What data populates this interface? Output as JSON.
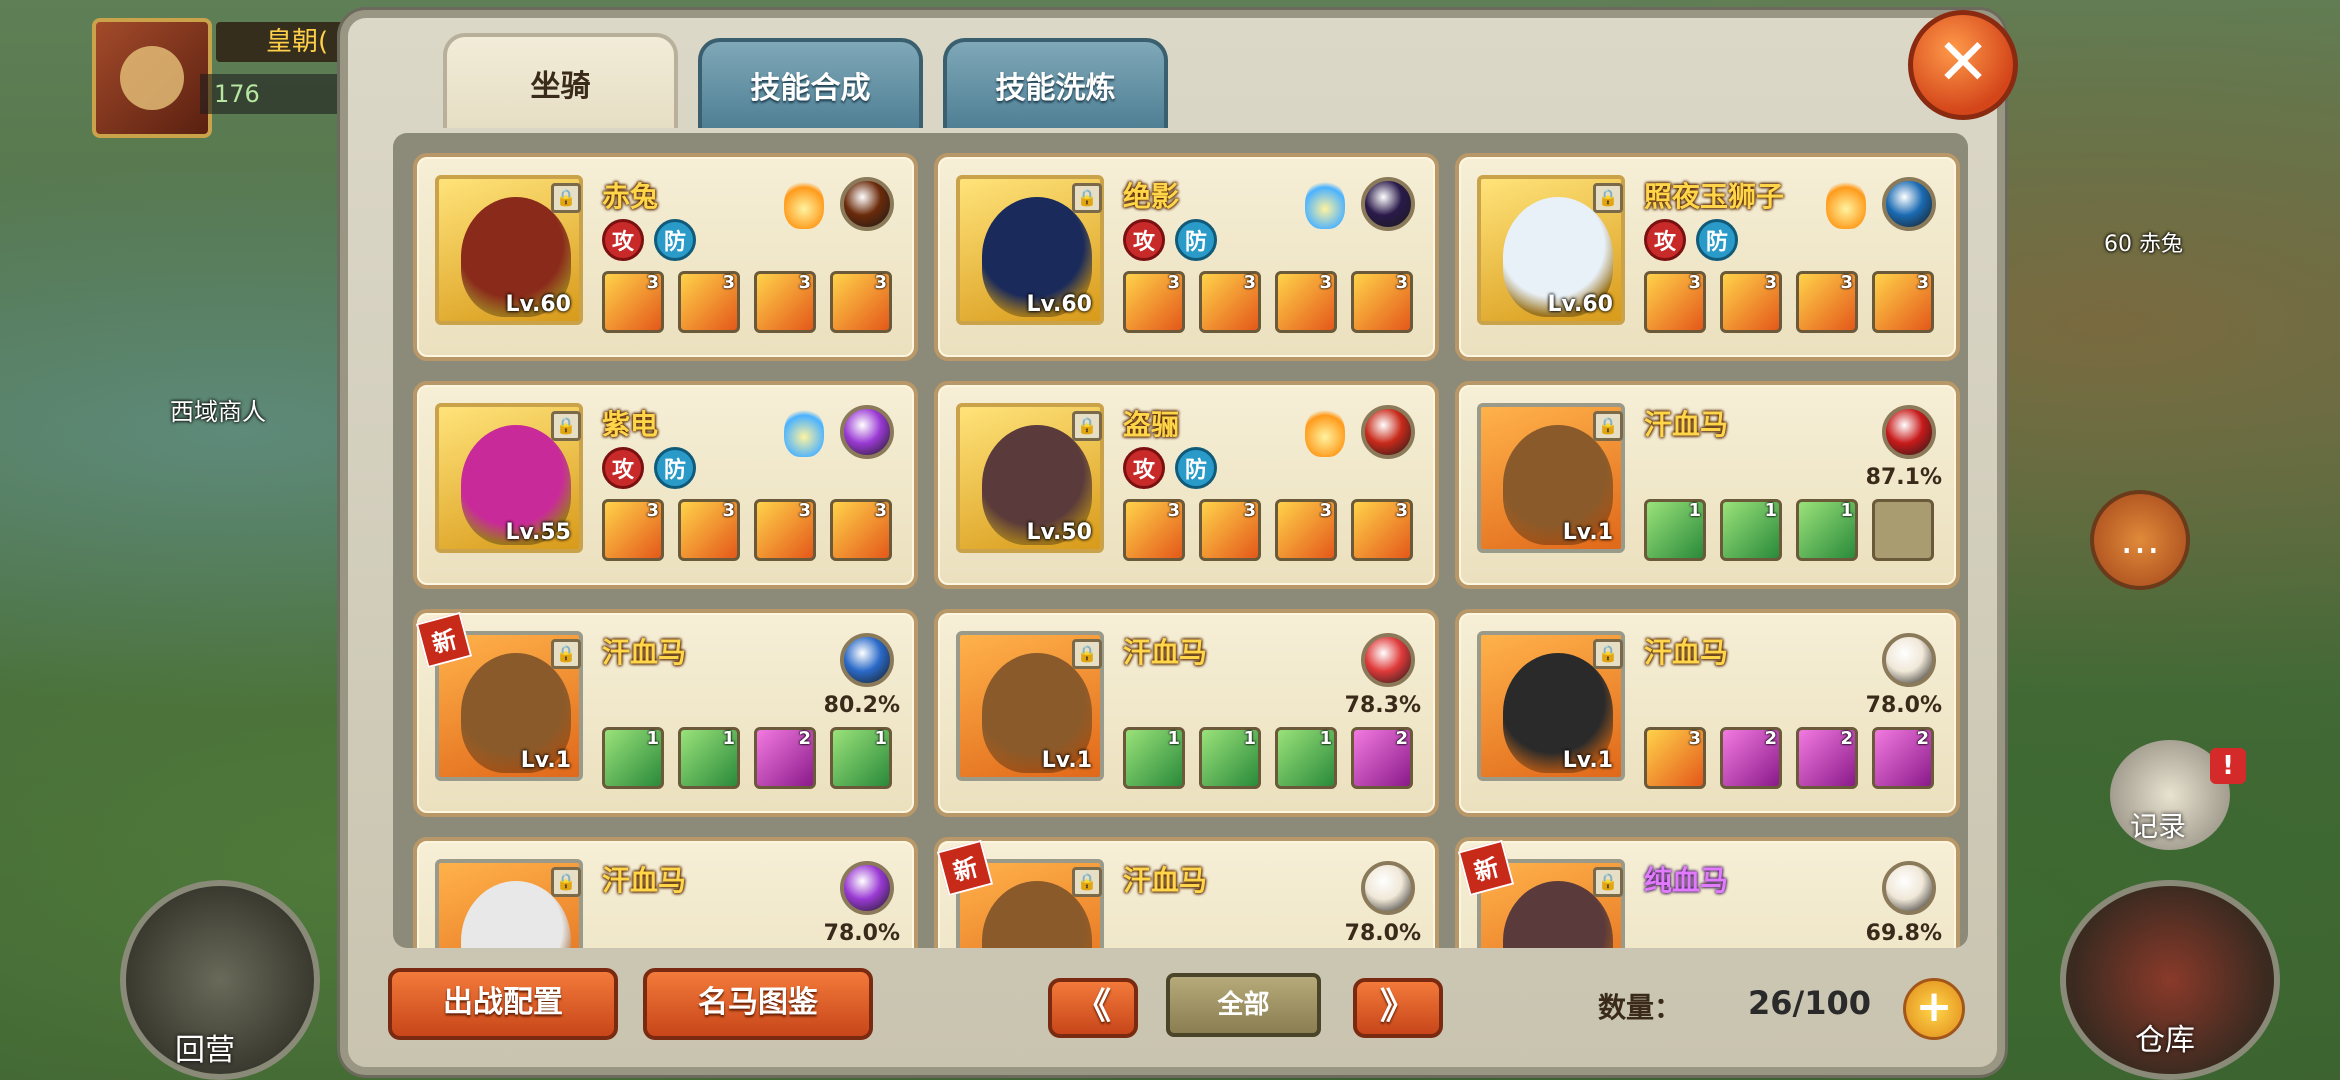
{
  "hud": {
    "title": "皇朝(",
    "level": "176"
  },
  "world": {
    "npc_label": "西域商人",
    "hero_label": "60  赤兔"
  },
  "side_buttons": {
    "home": "回营",
    "warehouse": "仓库",
    "record": "记录",
    "record_badge": "!"
  },
  "tabs": [
    {
      "label": "坐骑",
      "active": true
    },
    {
      "label": "技能合成",
      "active": false
    },
    {
      "label": "技能洗炼",
      "active": false
    }
  ],
  "close_label": "✕",
  "attr_labels": {
    "attack": "攻",
    "defense": "防"
  },
  "mounts": [
    {
      "name": "赤兔",
      "level": "Lv.60",
      "tier": "gold",
      "coat": "#8a2a1a",
      "elem": "#ff9a1a",
      "gem": "#6a2a0a",
      "attrs": true,
      "new": false,
      "percent": "",
      "skills": [
        {
          "type": "fire",
          "n": "3"
        },
        {
          "type": "fire",
          "n": "3"
        },
        {
          "type": "fire",
          "n": "3"
        },
        {
          "type": "fire",
          "n": "3"
        }
      ]
    },
    {
      "name": "绝影",
      "level": "Lv.60",
      "tier": "gold",
      "coat": "#1a2a5a",
      "elem": "#4ab2ff",
      "gem": "#2a1a4a",
      "attrs": true,
      "new": false,
      "percent": "",
      "skills": [
        {
          "type": "fire",
          "n": "3"
        },
        {
          "type": "fire",
          "n": "3"
        },
        {
          "type": "fire",
          "n": "3"
        },
        {
          "type": "fire",
          "n": "3"
        }
      ]
    },
    {
      "name": "照夜玉狮子",
      "level": "Lv.60",
      "tier": "gold",
      "coat": "#e8f0f8",
      "elem": "#ff9a1a",
      "gem": "#1a6ab2",
      "attrs": true,
      "new": false,
      "percent": "",
      "skills": [
        {
          "type": "fire",
          "n": "3"
        },
        {
          "type": "fire",
          "n": "3"
        },
        {
          "type": "fire",
          "n": "3"
        },
        {
          "type": "fire",
          "n": "3"
        }
      ]
    },
    {
      "name": "紫电",
      "level": "Lv.55",
      "tier": "gold",
      "coat": "#c82a9a",
      "elem": "#4ab2ff",
      "gem": "#9a3ad4",
      "attrs": true,
      "new": false,
      "percent": "",
      "skills": [
        {
          "type": "fire",
          "n": "3"
        },
        {
          "type": "fire",
          "n": "3"
        },
        {
          "type": "fire",
          "n": "3"
        },
        {
          "type": "fire",
          "n": "3"
        }
      ]
    },
    {
      "name": "盗骊",
      "level": "Lv.50",
      "tier": "gold",
      "coat": "#5a3a3a",
      "elem": "#ff9a1a",
      "gem": "#c82a1a",
      "attrs": true,
      "new": false,
      "percent": "",
      "skills": [
        {
          "type": "fire",
          "n": "3"
        },
        {
          "type": "fire",
          "n": "3"
        },
        {
          "type": "fire",
          "n": "3"
        },
        {
          "type": "fire",
          "n": "3"
        }
      ]
    },
    {
      "name": "汗血马",
      "level": "Lv.1",
      "tier": "orange",
      "coat": "#8a5a2a",
      "elem": "",
      "gem": "#c81a1a",
      "attrs": false,
      "new": false,
      "percent": "87.1%",
      "skills": [
        {
          "type": "green",
          "n": "1"
        },
        {
          "type": "green",
          "n": "1"
        },
        {
          "type": "green",
          "n": "1"
        },
        {
          "type": "empty",
          "n": ""
        }
      ]
    },
    {
      "name": "汗血马",
      "level": "Lv.1",
      "tier": "orange",
      "coat": "#8a5a2a",
      "elem": "",
      "gem": "#2a6ac8",
      "attrs": false,
      "new": true,
      "new_label": "新",
      "percent": "80.2%",
      "skills": [
        {
          "type": "green",
          "n": "1"
        },
        {
          "type": "green",
          "n": "1"
        },
        {
          "type": "purple",
          "n": "2"
        },
        {
          "type": "green",
          "n": "1"
        }
      ]
    },
    {
      "name": "汗血马",
      "level": "Lv.1",
      "tier": "orange",
      "coat": "#8a5a2a",
      "elem": "",
      "gem": "#e03a3a",
      "attrs": false,
      "new": false,
      "percent": "78.3%",
      "skills": [
        {
          "type": "green",
          "n": "1"
        },
        {
          "type": "green",
          "n": "1"
        },
        {
          "type": "green",
          "n": "1"
        },
        {
          "type": "purple",
          "n": "2"
        }
      ]
    },
    {
      "name": "汗血马",
      "level": "Lv.1",
      "tier": "orange",
      "coat": "#2a2a2a",
      "elem": "",
      "gem": "#f0e8d8",
      "attrs": false,
      "new": false,
      "percent": "78.0%",
      "skills": [
        {
          "type": "fire",
          "n": "3"
        },
        {
          "type": "purple",
          "n": "2"
        },
        {
          "type": "purple",
          "n": "2"
        },
        {
          "type": "purple",
          "n": "2"
        }
      ]
    },
    {
      "name": "汗血马",
      "level": "",
      "tier": "orange",
      "coat": "#e8e8e8",
      "elem": "",
      "gem": "#9a3ad4",
      "attrs": false,
      "new": false,
      "percent": "78.0%",
      "skills": []
    },
    {
      "name": "汗血马",
      "level": "",
      "tier": "orange",
      "coat": "#8a5a2a",
      "elem": "",
      "gem": "#f0e8d8",
      "attrs": false,
      "new": true,
      "new_label": "新",
      "percent": "78.0%",
      "skills": []
    },
    {
      "name": "纯血马",
      "level": "",
      "tier": "orange",
      "coat": "#5a3a3a",
      "elem": "",
      "gem": "#f0e8d8",
      "attrs": false,
      "new": true,
      "new_label": "新",
      "percent": "69.8%",
      "purple_name": true,
      "skills": []
    }
  ],
  "footer": {
    "deploy_label": "出战配置",
    "gallery_label": "名马图鉴",
    "prev_label": "《",
    "filter_label": "全部",
    "next_label": "》",
    "count_label": "数量：",
    "count_value": "26/100",
    "add_label": "+"
  }
}
